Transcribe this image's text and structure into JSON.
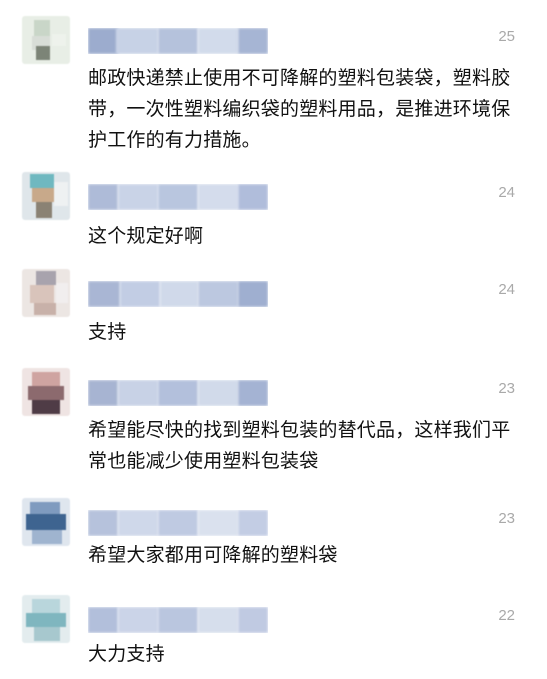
{
  "comments": [
    {
      "likes": "25",
      "text": "邮政快递禁止使用不可降解的塑料包装袋，塑料胶带，一次性塑料编织袋的塑料用品，是推进环境保护工作的有力措施。"
    },
    {
      "likes": "24",
      "text": "这个规定好啊"
    },
    {
      "likes": "24",
      "text": "支持"
    },
    {
      "likes": "23",
      "text": "希望能尽快的找到塑料包装的替代品，这样我们平常也能减少使用塑料包装袋"
    },
    {
      "likes": "23",
      "text": "希望大家都用可降解的塑料袋"
    },
    {
      "likes": "22",
      "text": "大力支持"
    }
  ],
  "colors": {
    "likes": "#a9a9a9",
    "text": "#111111",
    "blur_name": "#c5d0e4"
  },
  "icons": {
    "avatar": "blurred-avatar-image"
  }
}
